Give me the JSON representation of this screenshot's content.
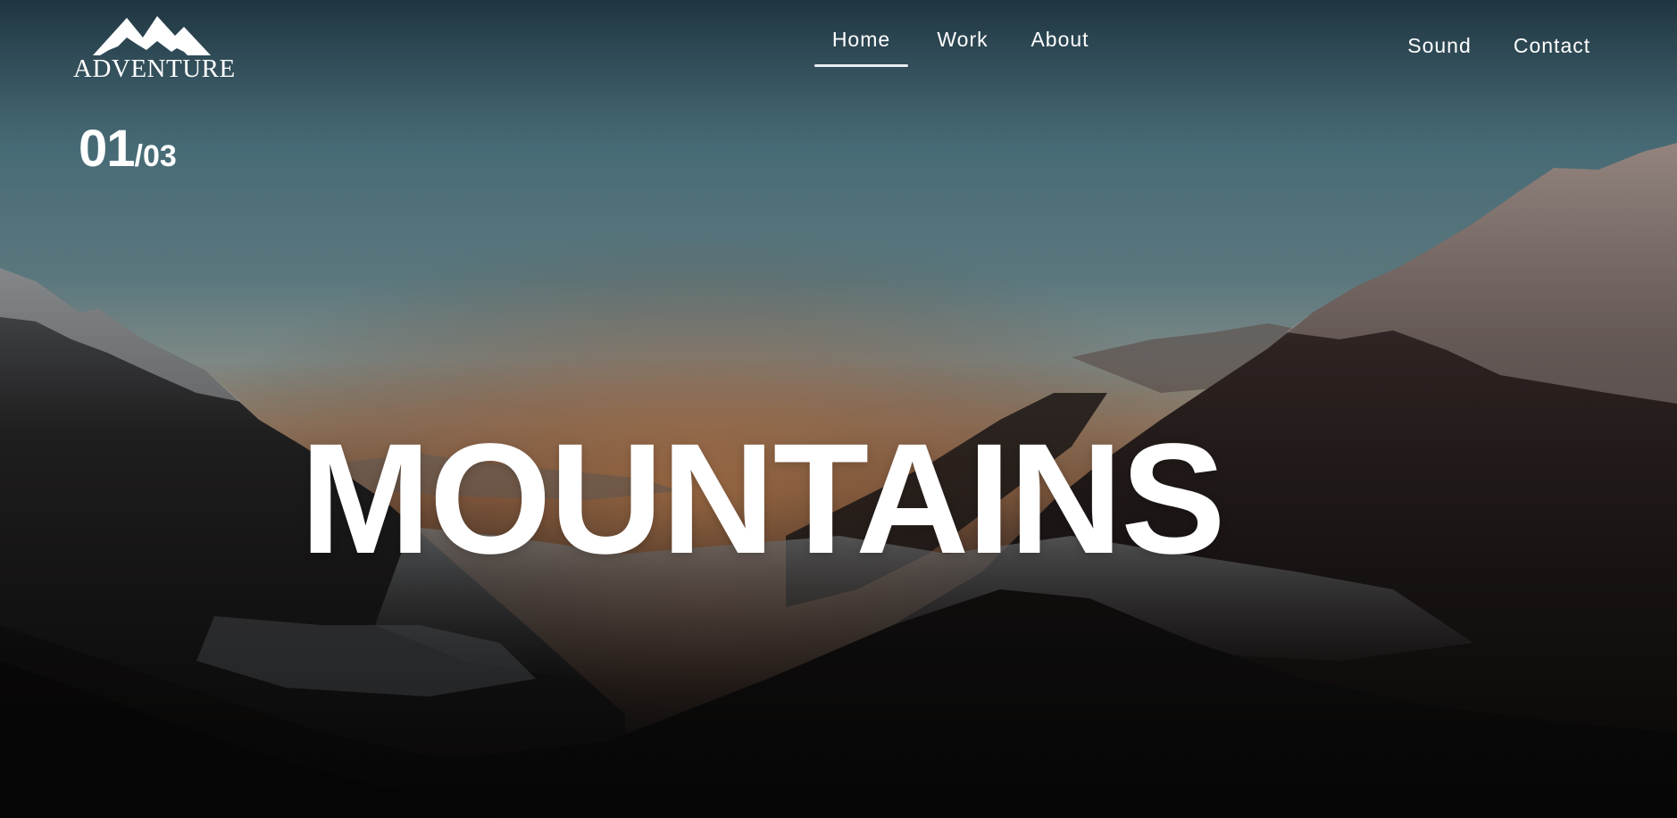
{
  "logo": {
    "text": "ADVENTURE",
    "icon": "mountain-peaks-icon"
  },
  "nav": {
    "main": [
      {
        "label": "Home",
        "active": true
      },
      {
        "label": "Work",
        "active": false
      },
      {
        "label": "About",
        "active": false
      }
    ],
    "secondary": [
      {
        "label": "Sound"
      },
      {
        "label": "Contact"
      }
    ]
  },
  "slide": {
    "current": "01",
    "total": "/03",
    "headline": "MOUNTAINS"
  },
  "colors": {
    "text": "#ffffff",
    "sky_top": "#203742",
    "sky_mid": "#4e7682",
    "horizon_glow": "#c98a5c",
    "mountain_dark": "#17120f"
  }
}
